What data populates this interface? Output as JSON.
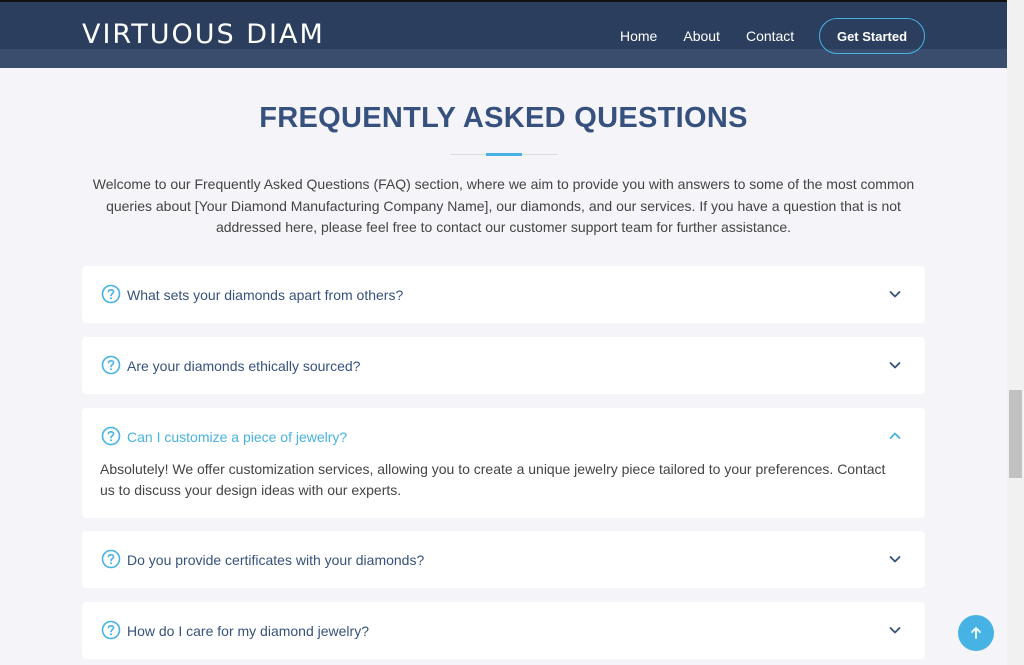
{
  "header": {
    "logo": "VIRTUOUS DIAM",
    "nav": [
      "Home",
      "About",
      "Contact"
    ],
    "cta": "Get Started"
  },
  "faq": {
    "title": "FREQUENTLY ASKED QUESTIONS",
    "intro": "Welcome to our Frequently Asked Questions (FAQ) section, where we aim to provide you with answers to some of the most common queries about [Your Diamond Manufacturing Company Name], our diamonds, and our services. If you have a question that is not addressed here, please feel free to contact our customer support team for further assistance.",
    "items": [
      {
        "question": "What sets your diamonds apart from others?",
        "open": false
      },
      {
        "question": "Are your diamonds ethically sourced?",
        "open": false
      },
      {
        "question": "Can I customize a piece of jewelry?",
        "open": true,
        "answer": "Absolutely! We offer customization services, allowing you to create a unique jewelry piece tailored to your preferences. Contact us to discuss your design ideas with our experts."
      },
      {
        "question": "Do you provide certificates with your diamonds?",
        "open": false
      },
      {
        "question": "How do I care for my diamond jewelry?",
        "open": false
      }
    ]
  },
  "icons": {
    "question": "help-circle-icon",
    "collapsed": "chevron-down-icon",
    "expanded": "chevron-up-icon",
    "back_to_top": "arrow-up-icon"
  },
  "colors": {
    "header_bg": "#2b3e5e",
    "heading": "#37517e",
    "accent": "#47b2e4",
    "page_bg": "#f4f4f9"
  }
}
